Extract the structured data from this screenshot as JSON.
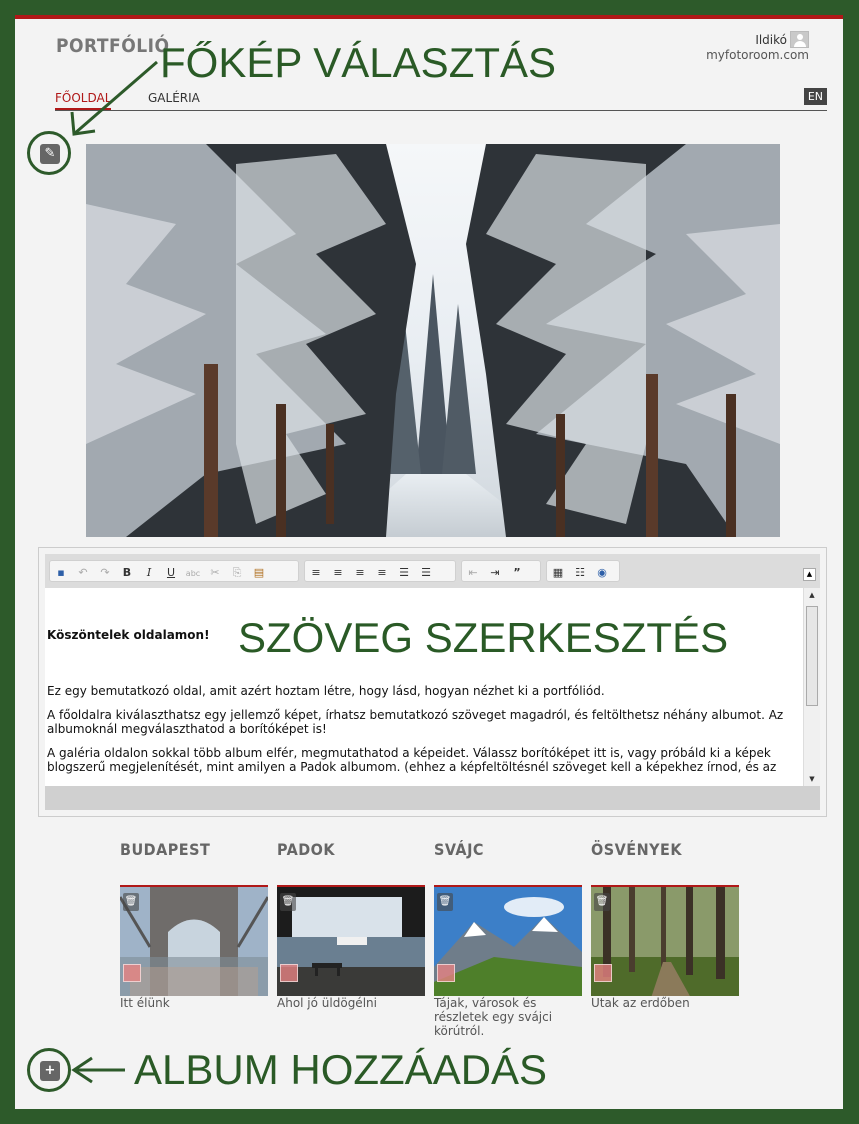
{
  "header": {
    "logo": "PORTFÓLIÓ",
    "user_name": "Ildikó",
    "domain": "myfotoroom.com",
    "lang": "EN"
  },
  "nav": {
    "tabs": [
      "FŐOLDAL",
      "GALÉRIA"
    ]
  },
  "annotations": {
    "main_image": "FŐKÉP VÁLASZTÁS",
    "text_edit": "SZÖVEG SZERKESZTÉS",
    "add_album": "ALBUM HOZZÁADÁS"
  },
  "editor": {
    "heading": "Köszöntelek oldalamon!",
    "paragraphs": [
      "Ez egy bemutatkozó oldal, amit azért hoztam létre, hogy lásd, hogyan nézhet ki a portfóliód.",
      "A főoldalra kiválaszthatsz egy jellemző képet, írhatsz bemutatkozó szöveget magadról, és feltölthetsz néhány albumot. Az albumoknál megválaszthatod a borítóképet is!",
      "A galéria oldalon sokkal több album elfér, megmutathatod a képeidet. Válassz borítóképet itt is, vagy próbáld ki a képek blogszerű megjelenítését, mint amilyen a Padok albumom. (ehhez a képfeltöltésnél szöveget kell a képekhez írnod, és az"
    ]
  },
  "albums": [
    {
      "title": "BUDAPEST",
      "desc": "Itt élünk"
    },
    {
      "title": "PADOK",
      "desc": "Ahol jó üldögélni"
    },
    {
      "title": "SVÁJC",
      "desc": "Tájak, városok és részletek egy svájci körútról."
    },
    {
      "title": "ÖSVÉNYEK",
      "desc": "Utak az erdőben"
    }
  ],
  "colors": {
    "accent": "#b01818",
    "frame": "#2d5a2a",
    "annotation": "#2a5a26"
  }
}
